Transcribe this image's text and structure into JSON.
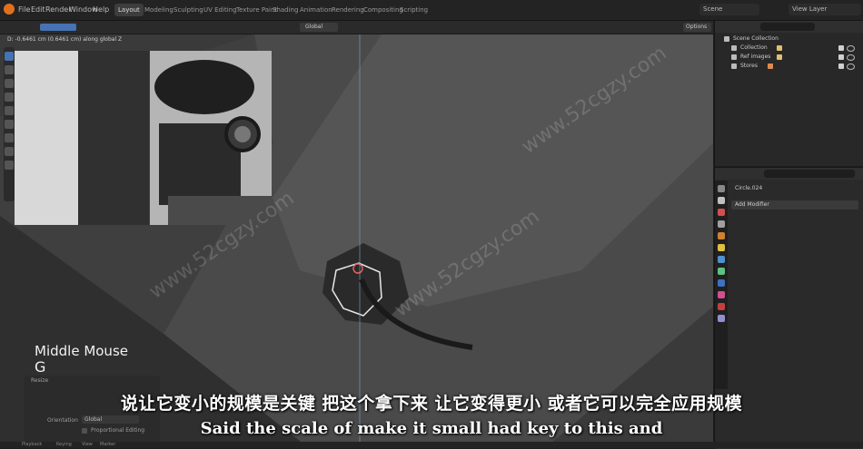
{
  "top_menu": [
    "File",
    "Edit",
    "Render",
    "Window",
    "Help"
  ],
  "workspaces": [
    "Layout",
    "Modeling",
    "Sculpting",
    "UV Editing",
    "Texture Paint",
    "Shading",
    "Animation",
    "Rendering",
    "Compositing",
    "Scripting"
  ],
  "active_workspace": "Layout",
  "scene_field": "Scene",
  "view_layer_field": "View Layer",
  "header": {
    "orientation": "Global",
    "options_label": "Options"
  },
  "operator_readout": "D: -0.6461 cm (0.6461 cm) along global Z",
  "key_overlay": {
    "mouse": "Middle Mouse",
    "key": "G"
  },
  "redo_panel": {
    "title": "Resize",
    "orientation_label": "Orientation",
    "orientation_value": "Global",
    "proportional_label": "Proportional Editing"
  },
  "outliner": {
    "root": "Scene Collection",
    "items": [
      {
        "label": "Collection",
        "icon_color": "#e0c070"
      },
      {
        "label": "Ref images",
        "icon_color": "#e0c070"
      },
      {
        "label": "Stores",
        "icon_color": "#e08a50"
      }
    ]
  },
  "properties": {
    "object_name": "Circle.024",
    "add_modifier": "Add Modifier",
    "tab_colors": [
      "#888888",
      "#c0c0c0",
      "#d05050",
      "#a0a0a0",
      "#d08030",
      "#e0c040",
      "#5090d0",
      "#60c080",
      "#4070c0",
      "#d05090",
      "#c04040",
      "#9090d0"
    ]
  },
  "subtitles": {
    "chinese": "说让它变小的规模是关键 把这个拿下来 让它变得更小 或者它可以完全应用规模",
    "english": "Said the scale of make it small had key to this and"
  },
  "bottom_bar": [
    "Playback",
    "Keying",
    "View",
    "Marker"
  ],
  "watermark": "www.52cgzy.com"
}
